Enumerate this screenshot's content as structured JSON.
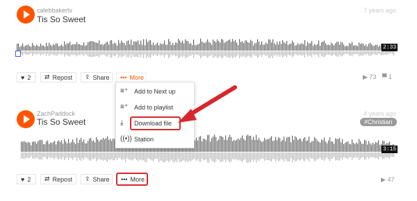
{
  "tracks": [
    {
      "user": "calebbakertv",
      "title": "Tis So Sweet",
      "age": "7 years ago",
      "duration": "2:33",
      "likes": "2",
      "repost_label": "Repost",
      "share_label": "Share",
      "more_label": "More",
      "plays": "73",
      "comments": "1",
      "tag": null
    },
    {
      "user": "ZachPaddock",
      "title": "Tis So Sweet",
      "age": "4 years ago",
      "duration": "3:15",
      "likes": "2",
      "repost_label": "Repost",
      "share_label": "Share",
      "more_label": "More",
      "plays": "47",
      "comments": null,
      "tag": "Christian"
    }
  ],
  "more_menu": {
    "items": [
      {
        "label": "Add to Next up",
        "icon": "add-to-next-up-icon"
      },
      {
        "label": "Add to playlist",
        "icon": "add-to-playlist-icon"
      },
      {
        "label": "Download file",
        "icon": "download-icon"
      },
      {
        "label": "Station",
        "icon": "station-icon"
      }
    ]
  },
  "colors": {
    "accent": "#ff5500",
    "highlight": "#d9262c",
    "waveform": "#666666",
    "waveform_reflection": "#bbbbbb"
  }
}
